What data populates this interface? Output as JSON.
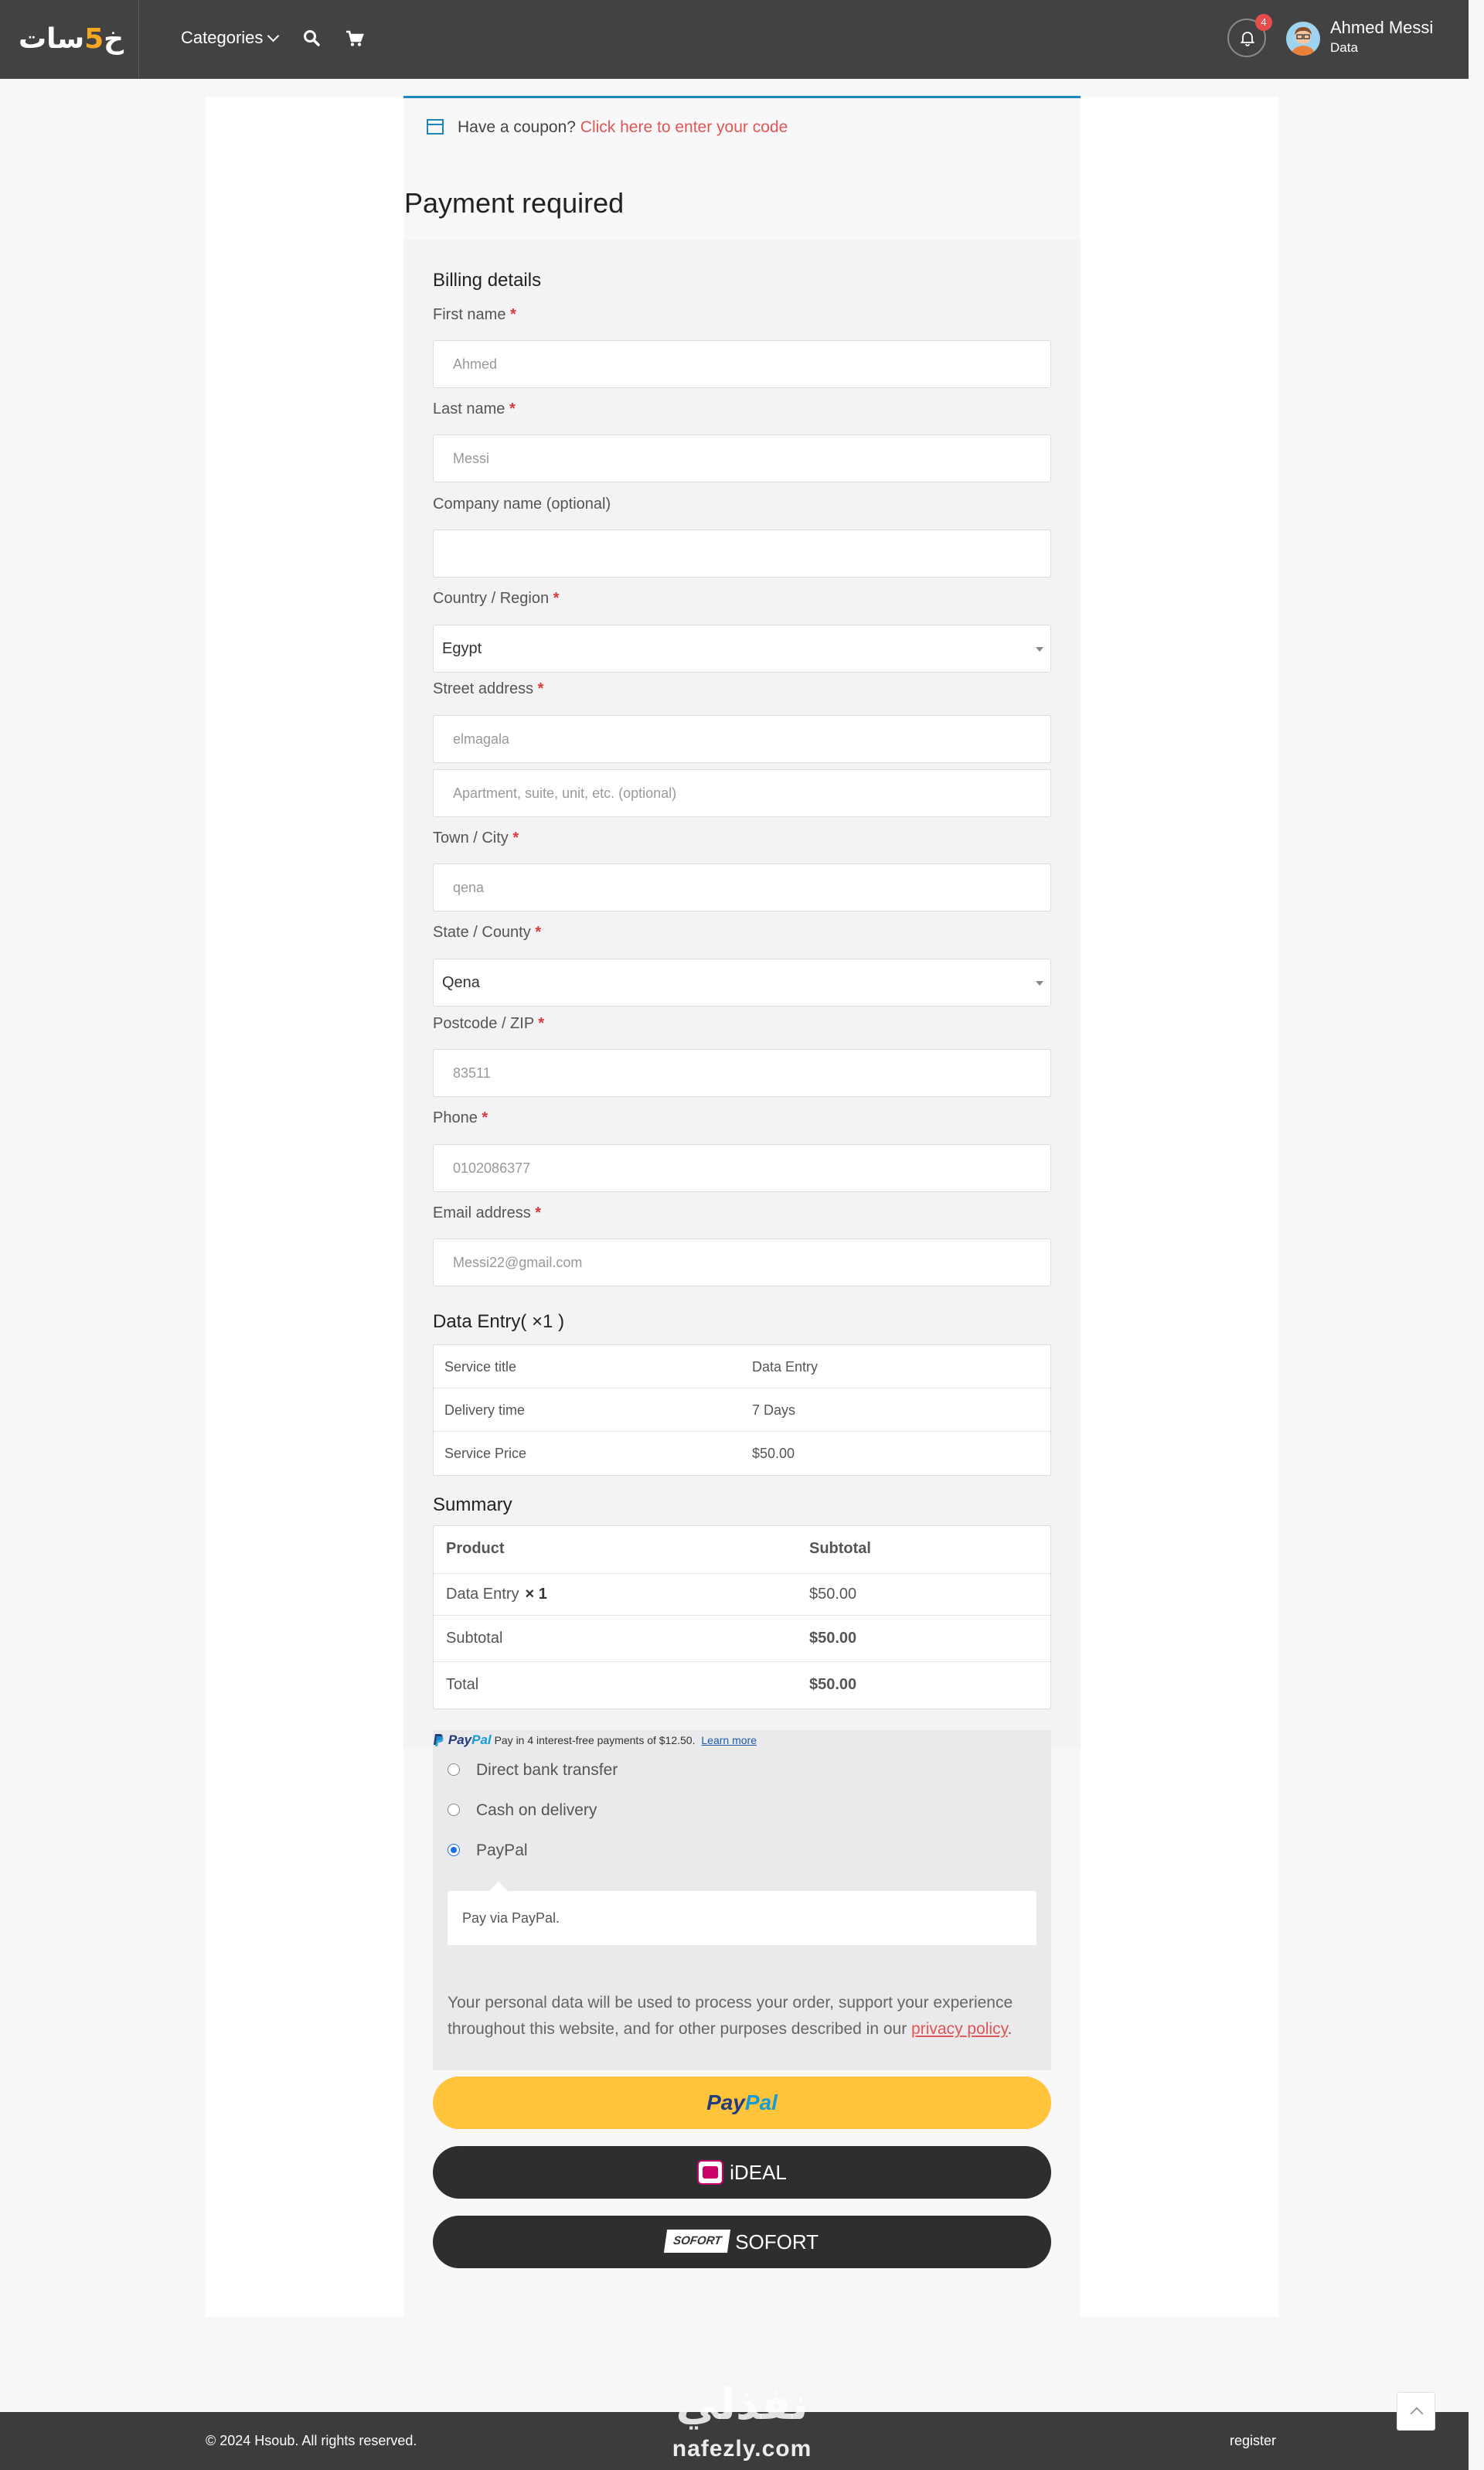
{
  "header": {
    "logo_text": "خمسات",
    "categories_label": "Categories",
    "notifications_count": "4",
    "user_name": "Ahmed Messi",
    "user_subtitle": "Data",
    "accent_color": "#f5a623",
    "icons": [
      "search-icon",
      "cart-icon",
      "bell-icon",
      "chevron-down-icon"
    ]
  },
  "coupon": {
    "text": "Have a coupon?",
    "link": "Click here to enter your code"
  },
  "page_title": "Payment required",
  "billing": {
    "heading": "Billing details",
    "first_name": {
      "label": "First name",
      "placeholder": "Ahmed"
    },
    "last_name": {
      "label": "Last name",
      "placeholder": "Messi"
    },
    "company": {
      "label": "Company name (optional)",
      "placeholder": ""
    },
    "country": {
      "label": "Country / Region",
      "value": "Egypt"
    },
    "street": {
      "label": "Street address",
      "placeholder": "elmagala",
      "placeholder2": "Apartment, suite, unit, etc. (optional)"
    },
    "city": {
      "label": "Town / City",
      "placeholder": "qena"
    },
    "state": {
      "label": "State / County",
      "value": "Qena"
    },
    "postcode": {
      "label": "Postcode / ZIP",
      "placeholder": "83511"
    },
    "phone": {
      "label": "Phone",
      "placeholder": "0102086377"
    },
    "email": {
      "label": "Email address",
      "placeholder": "Messi22@gmail.com"
    },
    "required_mark": "*"
  },
  "service": {
    "heading": "Data Entry( ×1 )",
    "rows": [
      {
        "label": "Service title",
        "value": "Data Entry"
      },
      {
        "label": "Delivery time",
        "value": "7 Days"
      },
      {
        "label": "Service Price",
        "value": "$50.00"
      }
    ]
  },
  "summary": {
    "heading": "Summary",
    "col_product": "Product",
    "col_subtotal": "Subtotal",
    "item_name": "Data Entry",
    "item_qty": "× 1",
    "item_price": "$50.00",
    "subtotal_label": "Subtotal",
    "subtotal_value": "$50.00",
    "total_label": "Total",
    "total_value": "$50.00"
  },
  "payment": {
    "paypal_logo_a": "Pay",
    "paypal_logo_b": "Pal",
    "paylater_text": "Pay in 4 interest-free payments of $12.50.",
    "learn_more": "Learn more",
    "methods": [
      {
        "label": "Direct bank transfer",
        "selected": false
      },
      {
        "label": "Cash on delivery",
        "selected": false
      },
      {
        "label": "PayPal",
        "selected": true
      }
    ],
    "method_description": "Pay via PayPal.",
    "privacy_text": "Your personal data will be used to process your order, support your experience throughout this website, and for other purposes described in our",
    "privacy_link": "privacy policy",
    "privacy_end": ".",
    "btn_paypal_a": "Pay",
    "btn_paypal_b": "Pal",
    "btn_ideal": "iDEAL",
    "btn_sofort": "SOFORT",
    "sofort_badge": "SOFORT",
    "paypal_button_color": "#ffc439",
    "dark_button_color": "#2c2e2f"
  },
  "footer": {
    "copyright": "© 2024 Hsoub. All rights reserved.",
    "register": "register",
    "watermark_ar": "نفذلي",
    "watermark_en": "nafezly.com"
  }
}
